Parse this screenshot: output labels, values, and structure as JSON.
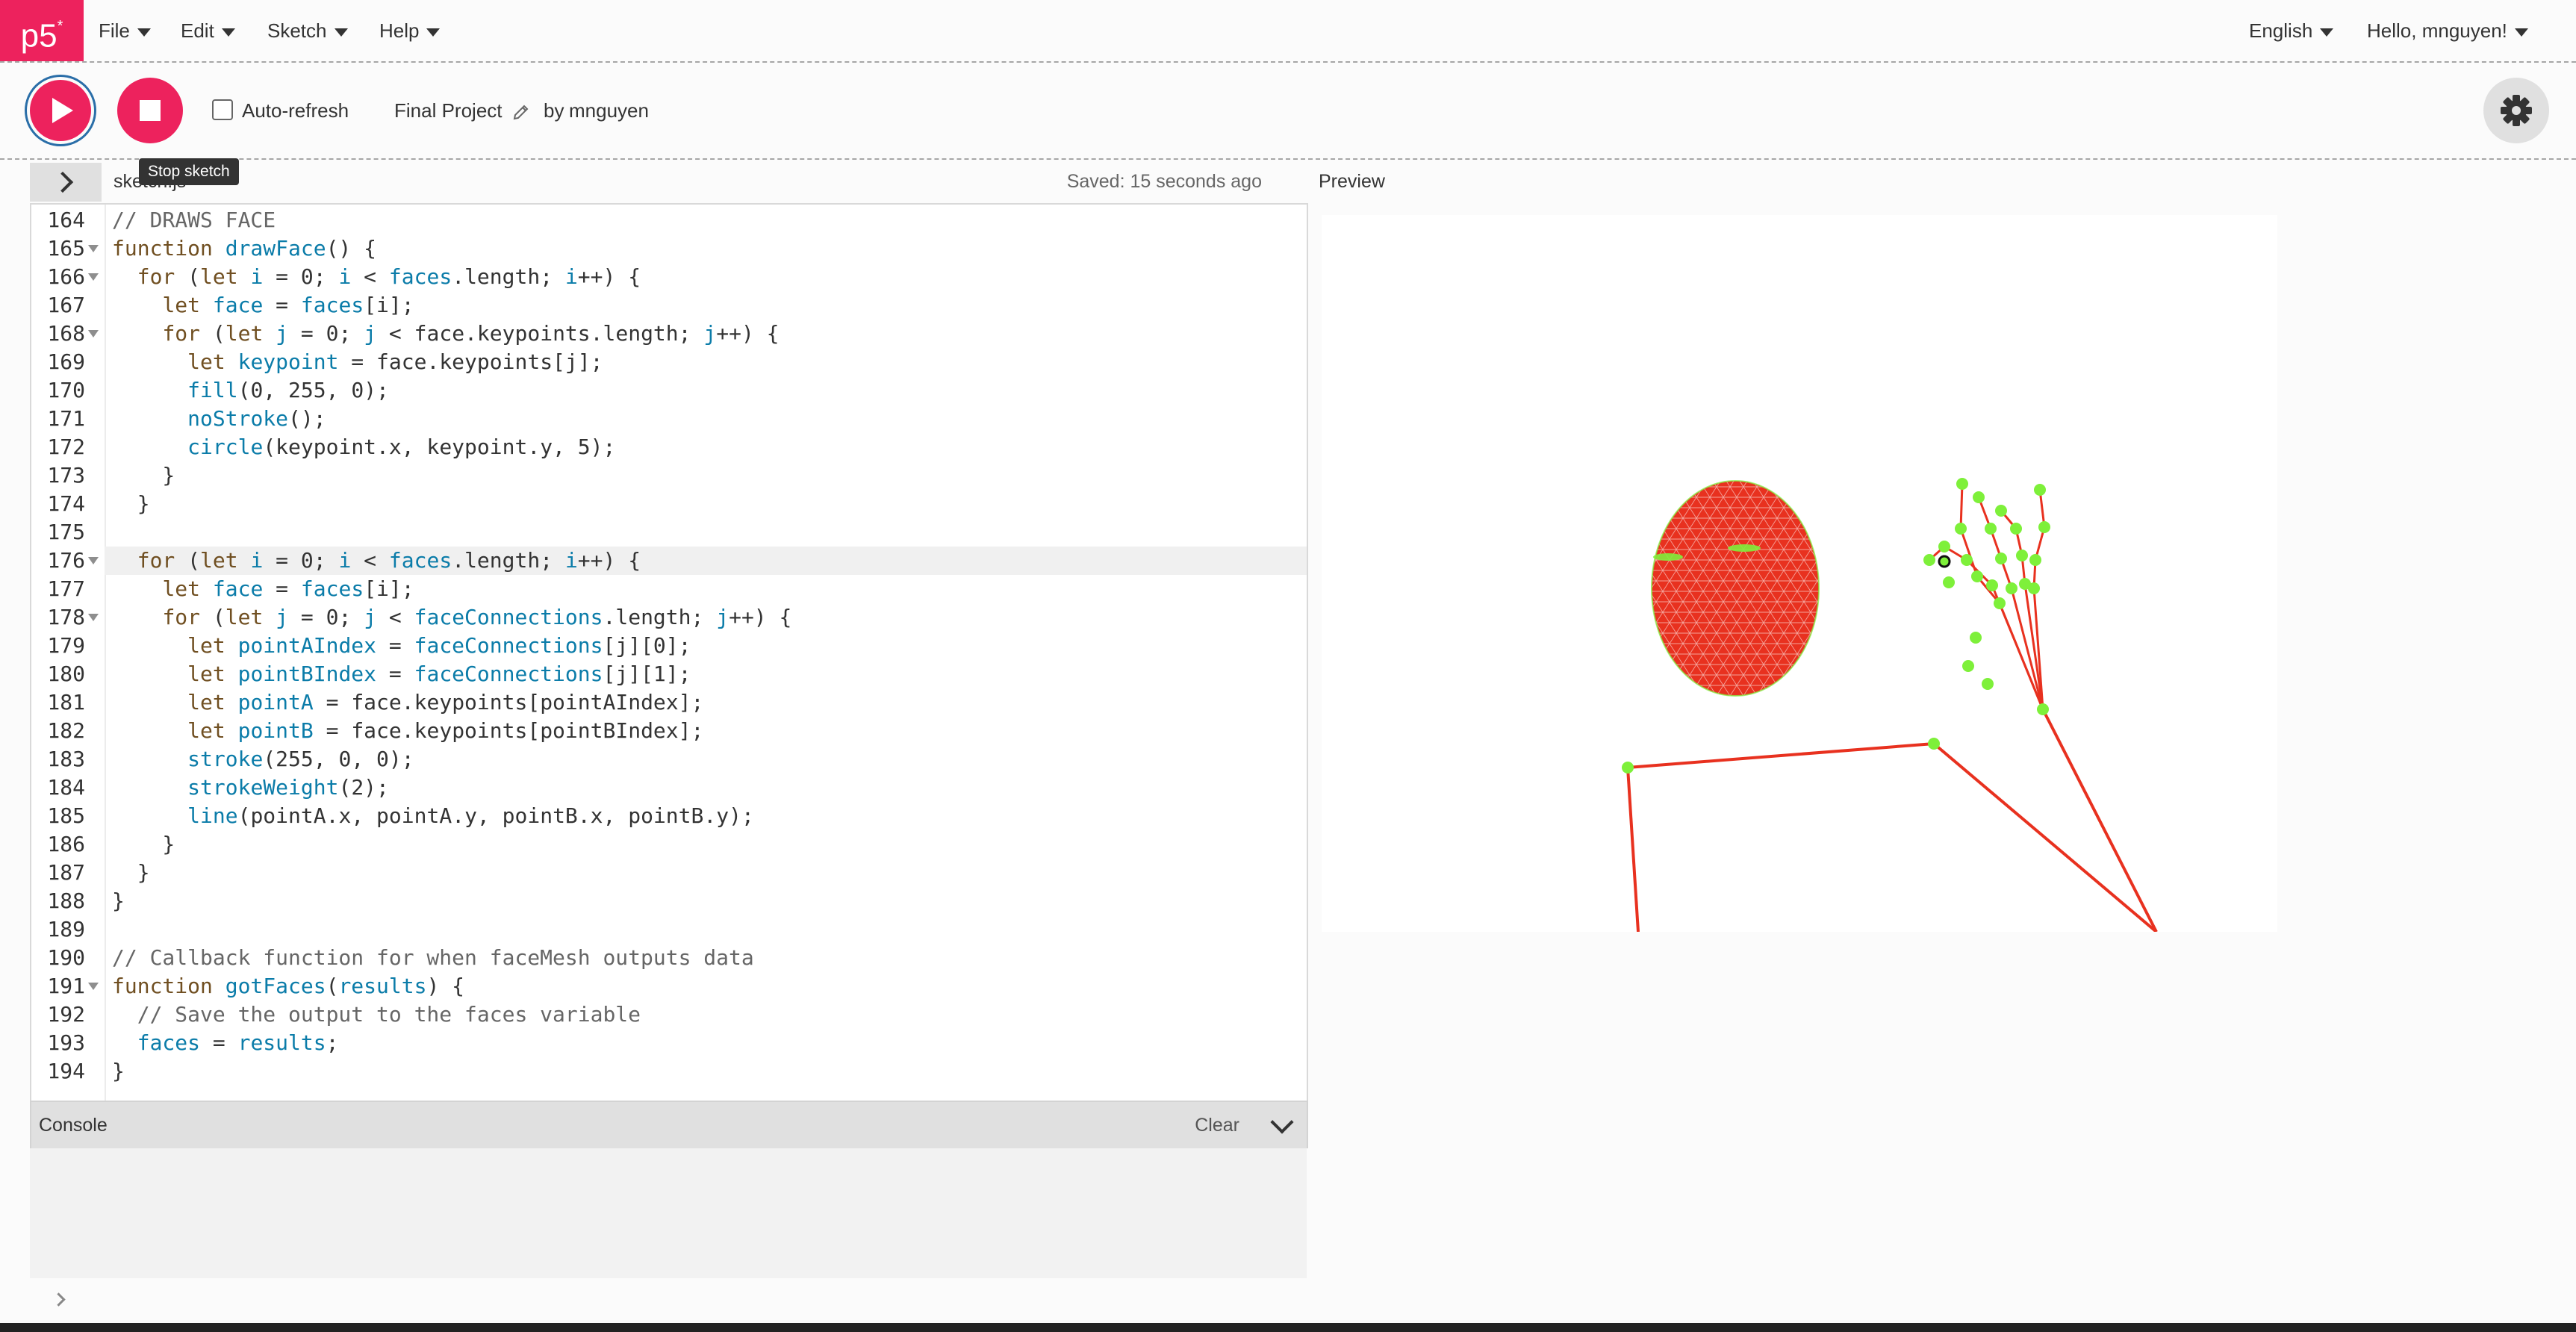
{
  "nav": {
    "logo": "p5",
    "logo_star": "*",
    "menus": [
      "File",
      "Edit",
      "Sketch",
      "Help"
    ],
    "language": "English",
    "user": "Hello, mnguyen!"
  },
  "toolbar": {
    "play_label": "Play",
    "stop_label": "Stop",
    "auto_refresh": "Auto-refresh",
    "auto_refresh_checked": false,
    "project_name": "Final Project",
    "by": "by",
    "author": "mnguyen",
    "tooltip": "Stop sketch"
  },
  "editor": {
    "file_tab": "sketch.js",
    "saved_status": "Saved: 15 seconds ago",
    "active_line": 176,
    "lines": [
      {
        "n": "164",
        "fold": false,
        "code": "// DRAWS FACE"
      },
      {
        "n": "165",
        "fold": true,
        "code": "function drawFace() {"
      },
      {
        "n": "166",
        "fold": true,
        "code": "  for (let i = 0; i < faces.length; i++) {"
      },
      {
        "n": "167",
        "fold": false,
        "code": "    let face = faces[i];"
      },
      {
        "n": "168",
        "fold": true,
        "code": "    for (let j = 0; j < face.keypoints.length; j++) {"
      },
      {
        "n": "169",
        "fold": false,
        "code": "      let keypoint = face.keypoints[j];"
      },
      {
        "n": "170",
        "fold": false,
        "code": "      fill(0, 255, 0);"
      },
      {
        "n": "171",
        "fold": false,
        "code": "      noStroke();"
      },
      {
        "n": "172",
        "fold": false,
        "code": "      circle(keypoint.x, keypoint.y, 5);"
      },
      {
        "n": "173",
        "fold": false,
        "code": "    }"
      },
      {
        "n": "174",
        "fold": false,
        "code": "  }"
      },
      {
        "n": "175",
        "fold": false,
        "code": ""
      },
      {
        "n": "176",
        "fold": true,
        "code": "  for (let i = 0; i < faces.length; i++) {"
      },
      {
        "n": "177",
        "fold": false,
        "code": "    let face = faces[i];"
      },
      {
        "n": "178",
        "fold": true,
        "code": "    for (let j = 0; j < faceConnections.length; j++) {"
      },
      {
        "n": "179",
        "fold": false,
        "code": "      let pointAIndex = faceConnections[j][0];"
      },
      {
        "n": "180",
        "fold": false,
        "code": "      let pointBIndex = faceConnections[j][1];"
      },
      {
        "n": "181",
        "fold": false,
        "code": "      let pointA = face.keypoints[pointAIndex];"
      },
      {
        "n": "182",
        "fold": false,
        "code": "      let pointB = face.keypoints[pointBIndex];"
      },
      {
        "n": "183",
        "fold": false,
        "code": "      stroke(255, 0, 0);"
      },
      {
        "n": "184",
        "fold": false,
        "code": "      strokeWeight(2);"
      },
      {
        "n": "185",
        "fold": false,
        "code": "      line(pointA.x, pointA.y, pointB.x, pointB.y);"
      },
      {
        "n": "186",
        "fold": false,
        "code": "    }"
      },
      {
        "n": "187",
        "fold": false,
        "code": "  }"
      },
      {
        "n": "188",
        "fold": false,
        "code": "}"
      },
      {
        "n": "189",
        "fold": false,
        "code": ""
      },
      {
        "n": "190",
        "fold": false,
        "code": "// Callback function for when faceMesh outputs data"
      },
      {
        "n": "191",
        "fold": true,
        "code": "function gotFaces(results) {"
      },
      {
        "n": "192",
        "fold": false,
        "code": "  // Save the output to the faces variable"
      },
      {
        "n": "193",
        "fold": false,
        "code": "  faces = results;"
      },
      {
        "n": "194",
        "fold": false,
        "code": "}"
      }
    ]
  },
  "console": {
    "title": "Console",
    "clear": "Clear"
  },
  "preview": {
    "label": "Preview"
  },
  "colors": {
    "accent": "#ed225d",
    "mesh": "#e8311f",
    "keypoint": "#7ef03a",
    "keyword": "#704f21",
    "identifier": "#0b7ca9"
  },
  "icons": [
    "play-icon",
    "stop-icon",
    "pencil-icon",
    "gear-icon",
    "chevron-right-icon",
    "chevron-down-icon",
    "caret-down-icon"
  ]
}
